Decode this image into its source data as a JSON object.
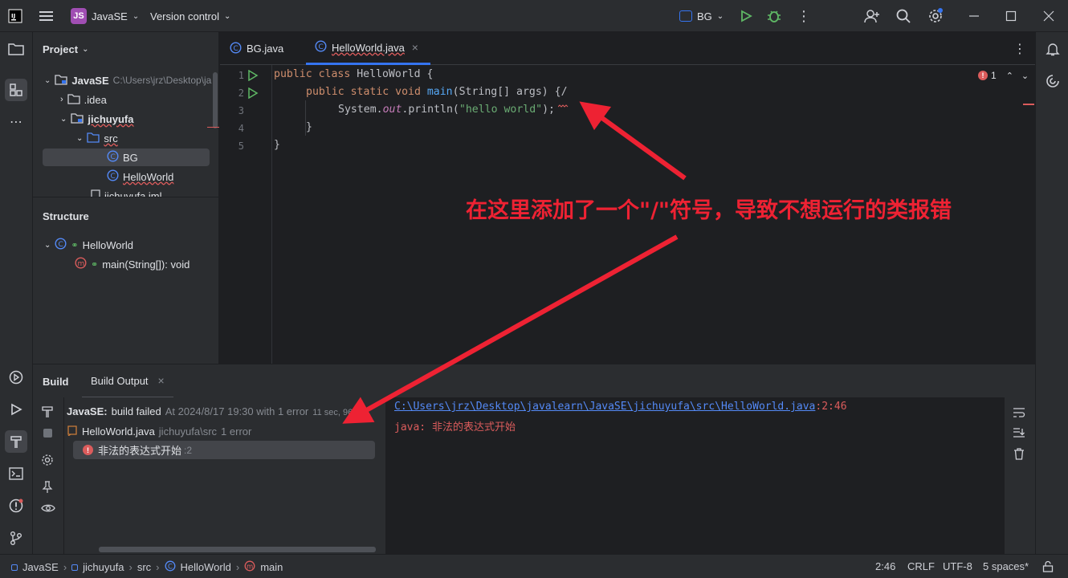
{
  "titlebar": {
    "project_badge": "JS",
    "project_name": "JavaSE",
    "vcs_label": "Version control",
    "run_config": "BG",
    "run_config_badge": "□"
  },
  "project_panel": {
    "title": "Project",
    "tree": [
      {
        "label": "JavaSE",
        "hint": "C:\\Users\\jrz\\Desktop\\ja"
      },
      {
        "label": ".idea"
      },
      {
        "label": "jichuyufa"
      },
      {
        "label": "src"
      },
      {
        "label": "BG"
      },
      {
        "label": "HelloWorld"
      },
      {
        "label": "jichuyufa.iml"
      }
    ]
  },
  "structure_panel": {
    "title": "Structure",
    "items": [
      {
        "label": "HelloWorld"
      },
      {
        "label": "main(String[]): void"
      }
    ]
  },
  "editor": {
    "tabs": [
      {
        "label": "BG.java"
      },
      {
        "label": "HelloWorld.java"
      }
    ],
    "error_count": "1",
    "line_numbers": [
      "1",
      "2",
      "3",
      "4",
      "5"
    ],
    "code": {
      "l1_kw": "public class ",
      "l1_name": "HelloWorld {",
      "l2_kw": "public static void ",
      "l2_fn": "main",
      "l2_rest": "(String[] args) {/",
      "l3_pre": "System.",
      "l3_out": "out",
      "l3_mid": ".println(",
      "l3_str": "\"hello world\"",
      "l3_end": ");",
      "l4": "}",
      "l5": "}"
    }
  },
  "annotation": "在这里添加了一个\"/\"符号，导致不想运行的类报错",
  "build": {
    "tab_build": "Build",
    "tab_output": "Build Output",
    "result_project": "JavaSE:",
    "result_text": "build failed",
    "result_time": "At 2024/8/17 19:30 with 1 error",
    "result_duration": "11 sec, 96",
    "file_name": "HelloWorld.java",
    "file_path": "jichuyufa\\src",
    "file_errors": "1 error",
    "error_message": "非法的表达式开始",
    "error_pos": ":2",
    "output_path": "C:\\Users\\jrz\\Desktop\\javalearn\\JavaSE\\jichuyufa\\src\\HelloWorld.java",
    "output_pos": ":2:46",
    "output_error": "java: 非法的表达式开始"
  },
  "statusbar": {
    "crumbs": [
      "JavaSE",
      "jichuyufa",
      "src",
      "HelloWorld",
      "main"
    ],
    "position": "2:46",
    "line_sep": "CRLF",
    "encoding": "UTF-8",
    "indent": "5 spaces*"
  },
  "colors": {
    "accent": "#3574f0",
    "error": "#db5c5c",
    "annotation": "#ee2233",
    "run_green": "#5fb865"
  }
}
